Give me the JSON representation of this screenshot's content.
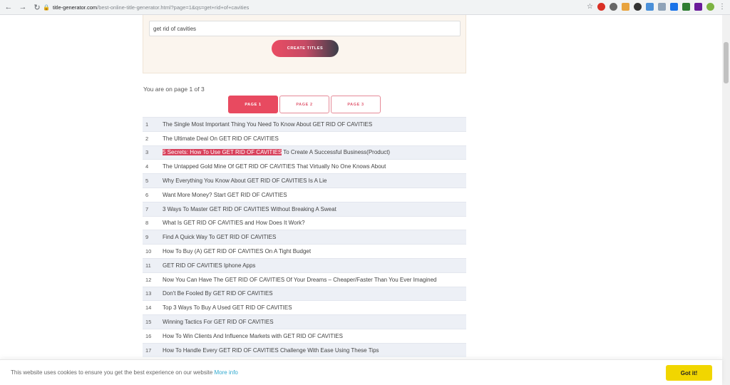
{
  "browser": {
    "url_host": "title-generator.com",
    "url_rest": "/best-online-title-generator.html?page=1&qs=get+rid+of+cavities"
  },
  "form": {
    "input_value": "get rid of cavities",
    "create_button_label": "CREATE TITLES"
  },
  "page_info": "You are on page 1 of 3",
  "pagination": [
    {
      "label": "PAGE 1",
      "active": true
    },
    {
      "label": "PAGE 2",
      "active": false
    },
    {
      "label": "PAGE 3",
      "active": false
    }
  ],
  "results": [
    {
      "n": "1",
      "text": "The Single Most Important Thing You Need To Know About GET RID OF CAVITIES"
    },
    {
      "n": "2",
      "text": "The Ultimate Deal On GET RID OF CAVITIES"
    },
    {
      "n": "3",
      "highlight": "5 Secrets: How To Use GET RID OF CAVITIES",
      "text": " To Create A Successful Business(Product)"
    },
    {
      "n": "4",
      "text": "The Untapped Gold Mine Of GET RID OF CAVITIES That Virtually No One Knows About"
    },
    {
      "n": "5",
      "text": "Why Everything You Know About GET RID OF CAVITIES Is A Lie"
    },
    {
      "n": "6",
      "text": "Want More Money? Start GET RID OF CAVITIES"
    },
    {
      "n": "7",
      "text": "3 Ways To Master GET RID OF CAVITIES Without Breaking A Sweat"
    },
    {
      "n": "8",
      "text": "What Is GET RID OF CAVITIES and How Does It Work?"
    },
    {
      "n": "9",
      "text": "Find A Quick Way To GET RID OF CAVITIES"
    },
    {
      "n": "10",
      "text": "How To Buy (A) GET RID OF CAVITIES On A Tight Budget"
    },
    {
      "n": "11",
      "text": "GET RID OF CAVITIES Iphone Apps"
    },
    {
      "n": "12",
      "text": "Now You Can Have The GET RID OF CAVITIES Of Your Dreams – Cheaper/Faster Than You Ever Imagined"
    },
    {
      "n": "13",
      "text": "Don't Be Fooled By GET RID OF CAVITIES"
    },
    {
      "n": "14",
      "text": "Top 3 Ways To Buy A Used GET RID OF CAVITIES"
    },
    {
      "n": "15",
      "text": "Winning Tactics For GET RID OF CAVITIES"
    },
    {
      "n": "16",
      "text": "How To Win Clients And Influence Markets with GET RID OF CAVITIES"
    },
    {
      "n": "17",
      "text": "How To Handle Every GET RID OF CAVITIES Challenge With Ease Using These Tips"
    }
  ],
  "cookie": {
    "message": "This website uses cookies to ensure you get the best experience on our website",
    "more_info": "More info",
    "button": "Got it!"
  },
  "colors": {
    "accent": "#e84a60",
    "panel_bg": "#fbf5ee",
    "cookie_button": "#f1d600"
  }
}
